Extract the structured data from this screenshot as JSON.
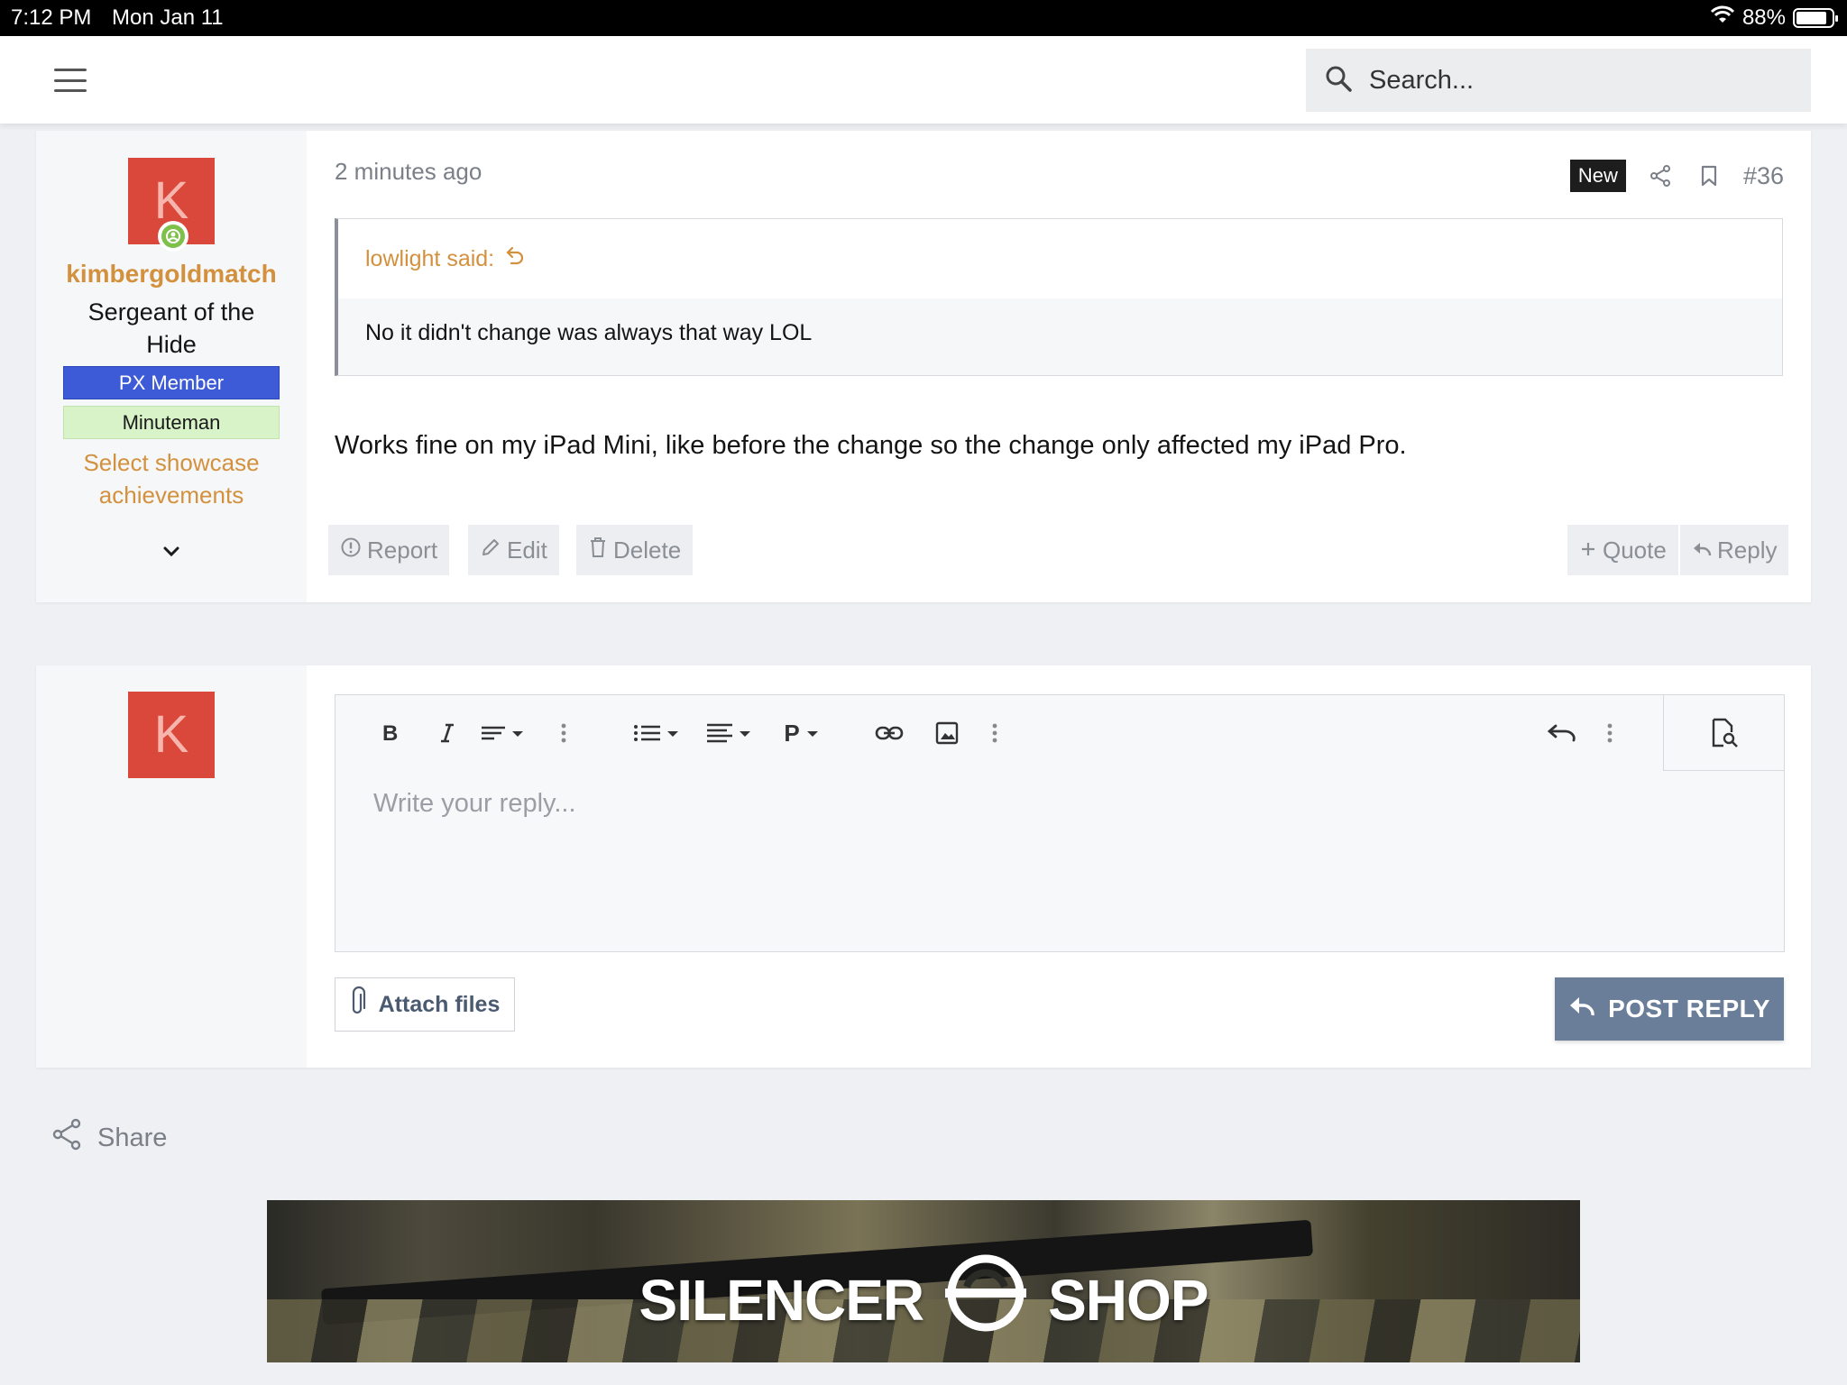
{
  "status_bar": {
    "time": "7:12 PM",
    "date": "Mon Jan 11",
    "battery": "88%",
    "battery_level": 0.88
  },
  "nav": {
    "search_placeholder": "Search..."
  },
  "post": {
    "avatar_letter": "K",
    "username": "kimbergoldmatch",
    "user_title": "Sergeant of the Hide",
    "banners": [
      "PX Member",
      "Minuteman"
    ],
    "showcase_link": "Select showcase achievements",
    "timestamp": "2 minutes ago",
    "new_badge": "New",
    "permalink": "#36",
    "quote": {
      "author": "lowlight said:",
      "text": "No it didn't change was always that way LOL"
    },
    "body": "Works fine on my iPad Mini, like before the change so the change only affected my iPad Pro.",
    "actions": {
      "report": "Report",
      "edit": "Edit",
      "delete": "Delete",
      "quote": "Quote",
      "reply": "Reply"
    }
  },
  "reply_form": {
    "avatar_letter": "K",
    "toolbar": {
      "paragraph_label": "P"
    },
    "placeholder": "Write your reply...",
    "attach_label": "Attach files",
    "post_label": "POST REPLY"
  },
  "share_label": "Share",
  "ad": {
    "brand_left": "SILENCER",
    "brand_right": "SHOP"
  },
  "colors": {
    "accent": "#d3913e",
    "avatar": "#d9483b",
    "px_member": "#3d5bd6",
    "minuteman": "#d8f3c8",
    "button_primary": "#6a7e9a"
  }
}
